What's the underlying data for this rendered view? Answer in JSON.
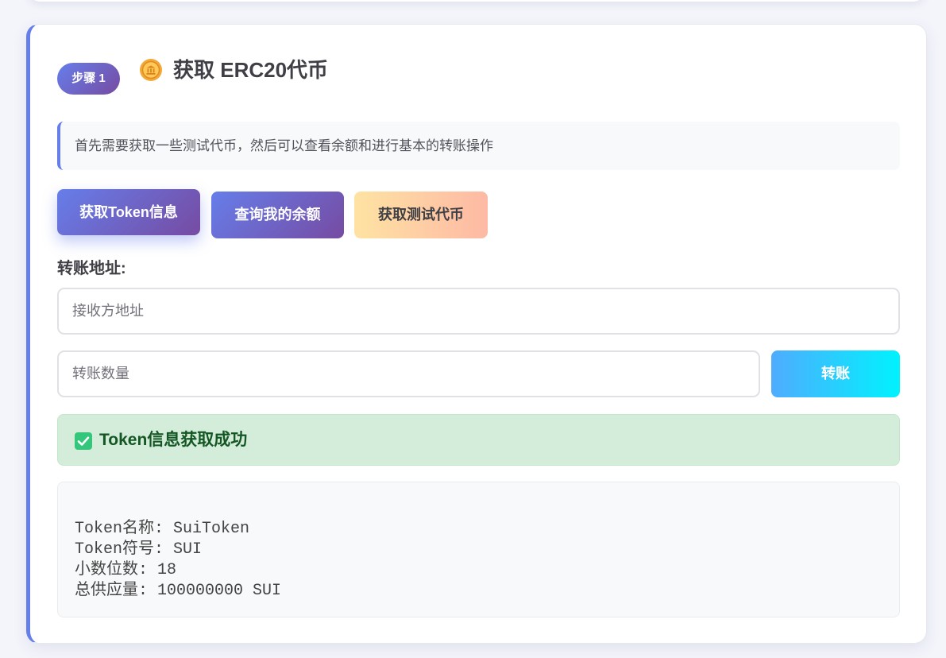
{
  "step": {
    "badge": "步骤 1",
    "icon": "coin-icon",
    "title": "获取 ERC20代币"
  },
  "info": {
    "text": "首先需要获取一些测试代币，然后可以查看余额和进行基本的转账操作"
  },
  "actions": {
    "get_token_info": "获取Token信息",
    "check_balance": "查询我的余额",
    "get_test_tokens": "获取测试代币"
  },
  "transfer": {
    "label": "转账地址:",
    "address_placeholder": "接收方地址",
    "amount_placeholder": "转账数量",
    "button": "转账"
  },
  "status": {
    "icon": "check-mark-icon",
    "message": "Token信息获取成功"
  },
  "result": {
    "lines": [
      "Token名称: SuiToken",
      "Token符号: SUI",
      "小数位数: 18",
      "总供应量: 100000000 SUI"
    ]
  },
  "colors": {
    "accent_gradient_start": "#667eea",
    "accent_gradient_end": "#764ba2",
    "faucet_gradient_start": "#ffe3a3",
    "faucet_gradient_end": "#fdb9a4",
    "transfer_gradient_start": "#4facfe",
    "transfer_gradient_end": "#00f2fe",
    "success_background": "#d4edda",
    "success_text": "#155724"
  }
}
